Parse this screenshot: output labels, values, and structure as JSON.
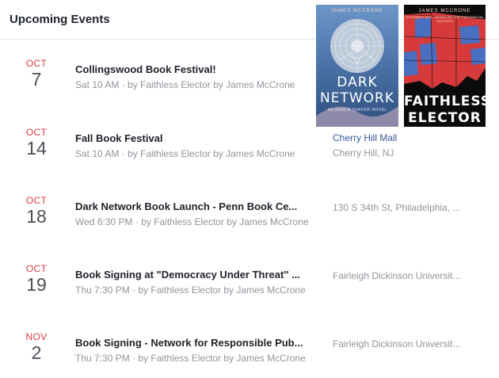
{
  "header": {
    "title": "Upcoming Events"
  },
  "covers": [
    {
      "author": "JAMES MCCRONE",
      "title_line1": "DARK",
      "title_line2": "NETWORK",
      "tagline": "AN ARDEN THAYER NOVEL",
      "colors": [
        "#6c95c8",
        "#2e4f7e"
      ]
    },
    {
      "author": "JAMES MCCRONE",
      "title_line1": "FAITHLESS",
      "title_line2": "ELECTOR",
      "tagline": "NOVEMBER 2016 · REVEALING THE PRESIDENTIAL ELECTION",
      "colors": [
        "#d63a3a",
        "#4a6fc0",
        "#0b0b0b"
      ]
    }
  ],
  "events": [
    {
      "month": "OCT",
      "day": "7",
      "title": "Collingswood Book Festival!",
      "subtitle": "Sat 10 AM · by Faithless Elector by James McCrone",
      "location_line1": "",
      "location_line2": ""
    },
    {
      "month": "OCT",
      "day": "14",
      "title": "Fall Book Festival",
      "subtitle": "Sat 10 AM · by Faithless Elector by James McCrone",
      "location_line1": "Cherry Hill Mall",
      "location_line2": "Cherry Hill, NJ"
    },
    {
      "month": "OCT",
      "day": "18",
      "title": "Dark Network Book Launch - Penn Book Ce...",
      "subtitle": "Wed 6:30 PM · by Faithless Elector by James McCrone",
      "location_line1": "130 S 34th St, Philadelphia, ...",
      "location_line2": ""
    },
    {
      "month": "OCT",
      "day": "19",
      "title": "Book Signing at \"Democracy Under Threat\" ...",
      "subtitle": "Thu 7:30 PM · by Faithless Elector by James McCrone",
      "location_line1": "Fairleigh Dickinson Universit...",
      "location_line2": ""
    },
    {
      "month": "NOV",
      "day": "2",
      "title": "Book Signing - Network for Responsible Pub...",
      "subtitle": "Thu 7:30 PM · by Faithless Elector by James McCrone",
      "location_line1": "Fairleigh Dickinson Universit...",
      "location_line2": ""
    }
  ],
  "colors": {
    "month": "#e0393e",
    "link": "#365899",
    "muted": "#90949c"
  }
}
